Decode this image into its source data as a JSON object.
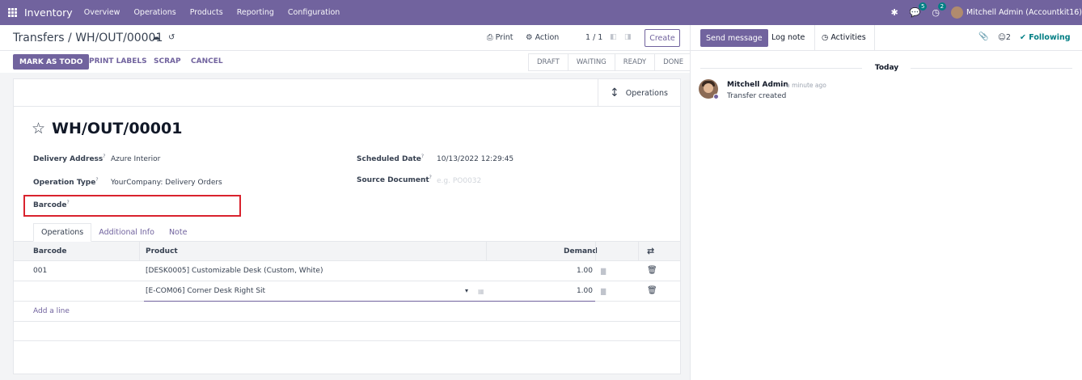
{
  "navbar": {
    "app_name": "Inventory",
    "menus": [
      "Overview",
      "Operations",
      "Products",
      "Reporting",
      "Configuration"
    ],
    "messages_count": "5",
    "activities_count": "2",
    "user": "Mitchell Admin (Accountkit16)"
  },
  "control_panel": {
    "breadcrumb": "Transfers / WH/OUT/00001",
    "print": "Print",
    "action": "Action",
    "pager": "1 / 1",
    "create": "Create"
  },
  "statusbar": {
    "buttons": [
      "MARK AS TODO",
      "PRINT LABELS",
      "SCRAP",
      "CANCEL"
    ],
    "stages": [
      "DRAFT",
      "WAITING",
      "READY",
      "DONE"
    ]
  },
  "form": {
    "operations_button": "Operations",
    "title": "WH/OUT/00001",
    "help": "?",
    "delivery_address_label": "Delivery Address",
    "delivery_address_value": "Azure Interior",
    "operation_type_label": "Operation Type",
    "operation_type_value": "YourCompany: Delivery Orders",
    "barcode_label": "Barcode",
    "scheduled_date_label": "Scheduled Date",
    "scheduled_date_value": "10/13/2022 12:29:45",
    "source_document_label": "Source Document",
    "source_document_placeholder": "e.g. PO0032"
  },
  "tabs": [
    "Operations",
    "Additional Info",
    "Note"
  ],
  "table": {
    "headers": {
      "barcode": "Barcode",
      "product": "Product",
      "demand": "Demand"
    },
    "rows": [
      {
        "barcode": "001",
        "product": "[DESK0005] Customizable Desk (Custom, White)",
        "demand": "1.00"
      },
      {
        "barcode": "",
        "product": "[E-COM06] Corner Desk Right Sit",
        "demand": "1.00"
      }
    ],
    "add_line": "Add a line"
  },
  "chatter": {
    "send_message": "Send message",
    "log_note": "Log note",
    "activities": "Activities",
    "followers": "2",
    "following": "Following",
    "today": "Today",
    "message": {
      "author": "Mitchell Admin",
      "time": "- a minute ago",
      "body": "Transfer created"
    }
  }
}
